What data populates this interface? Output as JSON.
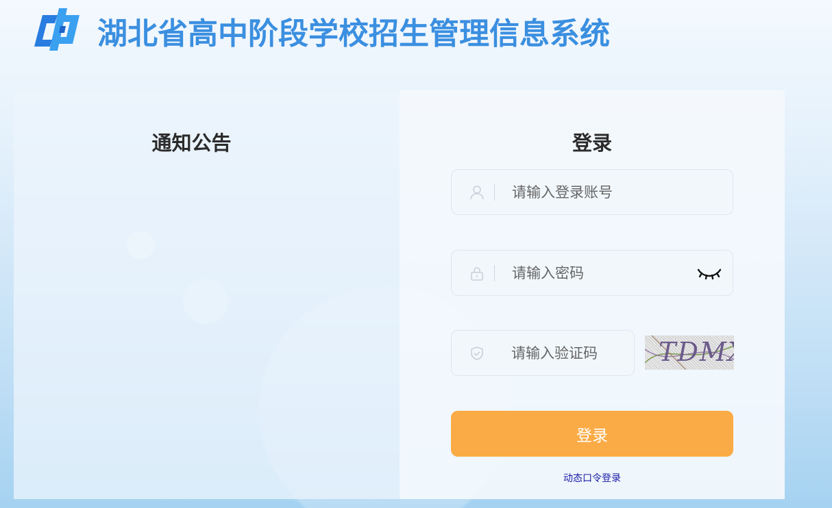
{
  "header": {
    "logo_icon": "hubei-education-logo-icon",
    "title": "湖北省高中阶段学校招生管理信息系统"
  },
  "notice": {
    "title": "通知公告"
  },
  "login": {
    "title": "登录",
    "username": {
      "placeholder": "请输入登录账号",
      "value": "",
      "icon": "user-icon"
    },
    "password": {
      "placeholder": "请输入密码",
      "value": "",
      "icon": "lock-icon",
      "toggle_icon": "eye-closed-icon"
    },
    "captcha_input": {
      "placeholder": "请输入验证码",
      "value": "",
      "icon": "shield-check-icon"
    },
    "captcha_image_text": "TDMX",
    "submit_label": "登录",
    "alt_login_label": "动态口令登录"
  },
  "colors": {
    "brand": "#3b8fe0",
    "submit": "#fbab45",
    "link": "#1a1aa6"
  }
}
